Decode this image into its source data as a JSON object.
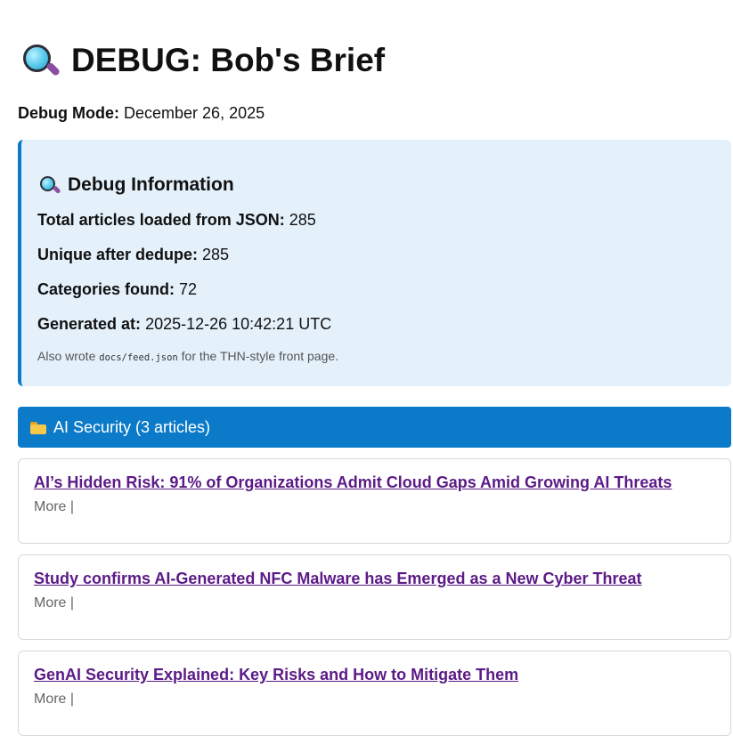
{
  "header": {
    "title": "DEBUG: Bob's Brief",
    "icon": "magnifying-glass-icon"
  },
  "debug_mode": {
    "label": "Debug Mode:",
    "value": "December 26, 2025"
  },
  "debug_info": {
    "title": "Debug Information",
    "icon": "magnifying-glass-icon",
    "lines": [
      {
        "label": "Total articles loaded from JSON:",
        "value": "285"
      },
      {
        "label": "Unique after dedupe:",
        "value": "285"
      },
      {
        "label": "Categories found:",
        "value": "72"
      },
      {
        "label": "Generated at:",
        "value": "2025-12-26 10:42:21 UTC"
      }
    ],
    "note": {
      "prefix": "Also wrote",
      "code": "docs/feed.json",
      "suffix": "for the THN-style front page."
    }
  },
  "category": {
    "icon": "folder-icon",
    "label": "AI Security (3 articles)",
    "color": "#0b7ac9"
  },
  "articles": [
    {
      "title": "AI’s Hidden Risk: 91% of Organizations Admit Cloud Gaps Amid Growing AI Threats",
      "more": "More |"
    },
    {
      "title": "Study confirms AI-Generated NFC Malware has Emerged as a New Cyber Threat",
      "more": "More |"
    },
    {
      "title": "GenAI Security Explained: Key Risks and How to Mitigate Them",
      "more": "More |"
    }
  ],
  "colors": {
    "accent": "#0b7ac9",
    "link": "#5b1a86",
    "debug_background": "#e4f1fb"
  }
}
